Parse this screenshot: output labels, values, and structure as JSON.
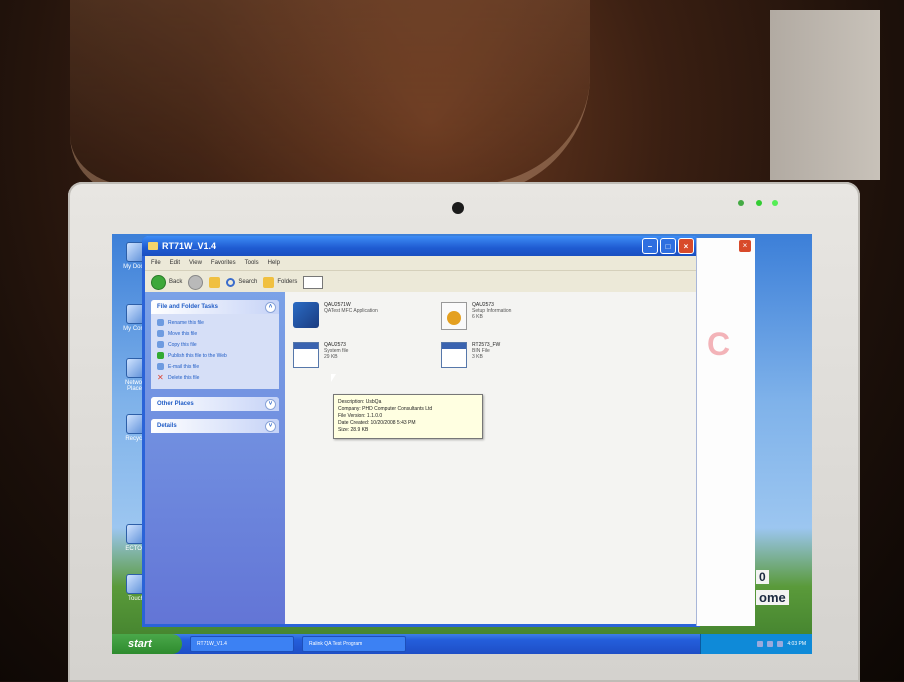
{
  "window": {
    "title": "RT71W_V1.4",
    "menu": [
      "File",
      "Edit",
      "View",
      "Favorites",
      "Tools",
      "Help"
    ],
    "toolbar": {
      "back": "Back",
      "search": "Search",
      "folders": "Folders"
    }
  },
  "desktop_icons": [
    {
      "label": "My Docur"
    },
    {
      "label": "My Comp"
    },
    {
      "label": "Network Places"
    },
    {
      "label": "Recycle"
    },
    {
      "label": "ECTOO"
    },
    {
      "label": "Touch"
    }
  ],
  "taskpane": {
    "file_folder_tasks": {
      "title": "File and Folder Tasks",
      "items": [
        "Rename this file",
        "Move this file",
        "Copy this file",
        "Publish this file to the Web",
        "E-mail this file",
        "Delete this file"
      ]
    },
    "other_places": {
      "title": "Other Places"
    },
    "details": {
      "title": "Details"
    }
  },
  "files": [
    {
      "name": "QAU2571W",
      "type": "QATest MFC Application",
      "size": ""
    },
    {
      "name": "QAU2573",
      "type": "Setup Information",
      "size": "6 KB"
    },
    {
      "name": "QAU2573",
      "type": "System file",
      "size": "29 KB"
    },
    {
      "name": "RT2573_FW",
      "type": "BIN File",
      "size": "3 KB"
    }
  ],
  "tooltip": {
    "lines": [
      "Description: UsbQa",
      "Company: PHD Computer Consultants Ltd",
      "File Version: 1.1.0.0",
      "Date Created: 10/20/2008 5:43 PM",
      "Size: 28.9 KB"
    ]
  },
  "side_window": {
    "letter": "C",
    "edge_text_1": "0",
    "edge_text_2": "ome"
  },
  "taskbar": {
    "start": "start",
    "tasks": [
      "RT71W_V1.4",
      "Ralink QA Test Program"
    ],
    "clock": "4:03 PM"
  }
}
